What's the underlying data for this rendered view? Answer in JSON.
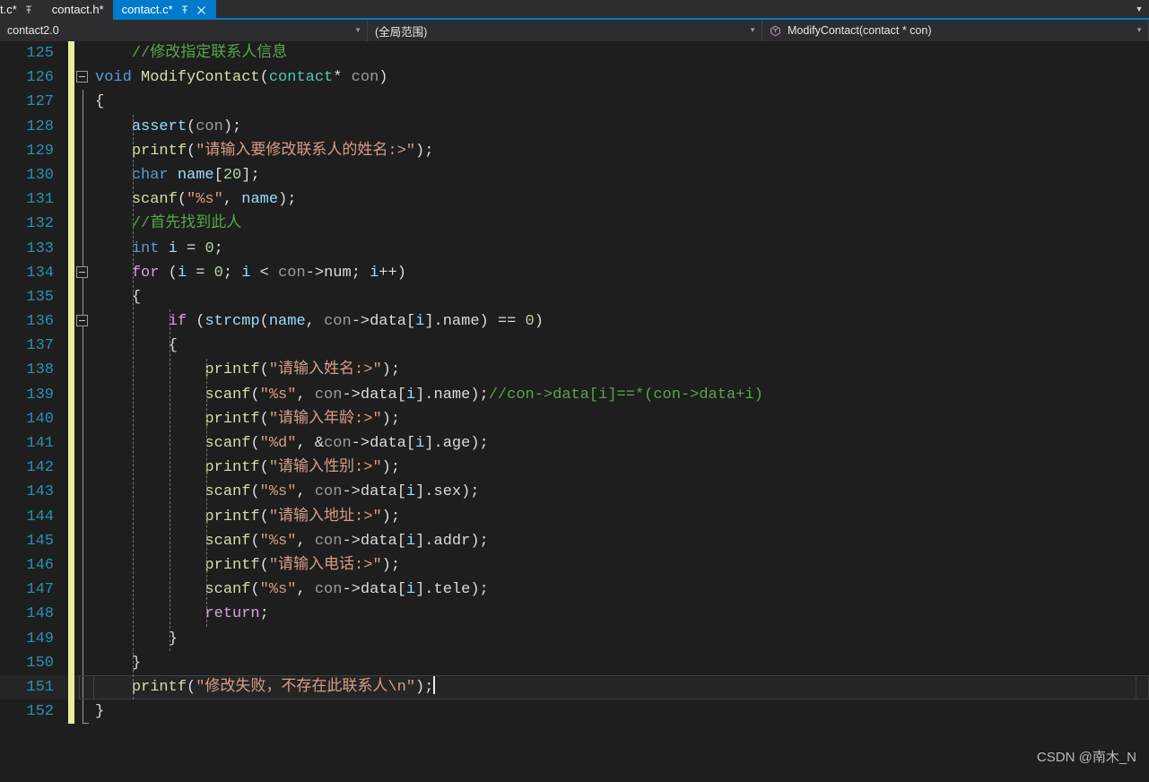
{
  "window": {
    "theme_bg": "#1e1e1e",
    "accent": "#007acc"
  },
  "tabs": [
    {
      "label": "t.c*",
      "state": "partial-left",
      "active": false,
      "pin": true,
      "close": false
    },
    {
      "label": "contact.h*",
      "state": "inactive",
      "active": false,
      "pin": false,
      "close": false
    },
    {
      "label": "contact.c*",
      "state": "active",
      "active": true,
      "pin": true,
      "close": true
    }
  ],
  "tabstrip": {
    "overflow_icon": "chevron-down-icon"
  },
  "navbar": {
    "project": "contact2.0",
    "scope": "(全局范围)",
    "member": "ModifyContact(contact * con)",
    "member_icon": "method-cube-icon",
    "dropdown_icon": "chevron-down-icon"
  },
  "editor": {
    "first_line": 125,
    "current_line": 151,
    "lines": [
      {
        "n": 125,
        "changed": true,
        "collapse": false,
        "tokens": [
          {
            "t": "    ",
            "c": "k-pun"
          },
          {
            "t": "//修改指定联系人信息",
            "c": "k-cmt"
          }
        ]
      },
      {
        "n": 126,
        "changed": true,
        "collapse": true,
        "vline": false,
        "tokens": [
          {
            "t": "void ",
            "c": "k-blue"
          },
          {
            "t": "ModifyContact",
            "c": "k-fn"
          },
          {
            "t": "(",
            "c": "k-pun"
          },
          {
            "t": "contact",
            "c": "k-type"
          },
          {
            "t": "* ",
            "c": "k-pun"
          },
          {
            "t": "con",
            "c": "k-dim"
          },
          {
            "t": ")",
            "c": "k-pun"
          }
        ]
      },
      {
        "n": 127,
        "changed": true,
        "vline": true,
        "tokens": [
          {
            "t": "{",
            "c": "k-brk"
          }
        ]
      },
      {
        "n": 128,
        "changed": true,
        "vline": true,
        "tokens": [
          {
            "t": "    ",
            "c": "k-pun"
          },
          {
            "t": "assert",
            "c": "k-var"
          },
          {
            "t": "(",
            "c": "k-pun"
          },
          {
            "t": "con",
            "c": "k-dim"
          },
          {
            "t": ");",
            "c": "k-pun"
          }
        ]
      },
      {
        "n": 129,
        "changed": true,
        "vline": true,
        "tokens": [
          {
            "t": "    ",
            "c": "k-pun"
          },
          {
            "t": "printf",
            "c": "k-fn"
          },
          {
            "t": "(",
            "c": "k-pun"
          },
          {
            "t": "\"请输入要修改联系人的姓名:>\"",
            "c": "k-str"
          },
          {
            "t": ");",
            "c": "k-pun"
          }
        ]
      },
      {
        "n": 130,
        "changed": true,
        "vline": true,
        "tokens": [
          {
            "t": "    ",
            "c": "k-pun"
          },
          {
            "t": "char ",
            "c": "k-blue"
          },
          {
            "t": "name",
            "c": "k-var"
          },
          {
            "t": "[",
            "c": "k-pun"
          },
          {
            "t": "20",
            "c": "k-num"
          },
          {
            "t": "];",
            "c": "k-pun"
          }
        ]
      },
      {
        "n": 131,
        "changed": true,
        "vline": true,
        "tokens": [
          {
            "t": "    ",
            "c": "k-pun"
          },
          {
            "t": "scanf",
            "c": "k-fn"
          },
          {
            "t": "(",
            "c": "k-pun"
          },
          {
            "t": "\"%s\"",
            "c": "k-str"
          },
          {
            "t": ", ",
            "c": "k-pun"
          },
          {
            "t": "name",
            "c": "k-var"
          },
          {
            "t": ");",
            "c": "k-pun"
          }
        ]
      },
      {
        "n": 132,
        "changed": true,
        "vline": true,
        "tokens": [
          {
            "t": "    ",
            "c": "k-pun"
          },
          {
            "t": "//首先找到此人",
            "c": "k-cmt"
          }
        ]
      },
      {
        "n": 133,
        "changed": true,
        "vline": true,
        "tokens": [
          {
            "t": "    ",
            "c": "k-pun"
          },
          {
            "t": "int ",
            "c": "k-blue"
          },
          {
            "t": "i",
            "c": "k-var"
          },
          {
            "t": " = ",
            "c": "k-pun"
          },
          {
            "t": "0",
            "c": "k-num"
          },
          {
            "t": ";",
            "c": "k-pun"
          }
        ]
      },
      {
        "n": 134,
        "changed": true,
        "collapse": true,
        "vline": true,
        "tokens": [
          {
            "t": "    ",
            "c": "k-pun"
          },
          {
            "t": "for",
            "c": "k-pink"
          },
          {
            "t": " (",
            "c": "k-pun"
          },
          {
            "t": "i",
            "c": "k-var"
          },
          {
            "t": " = ",
            "c": "k-pun"
          },
          {
            "t": "0",
            "c": "k-num"
          },
          {
            "t": "; ",
            "c": "k-pun"
          },
          {
            "t": "i",
            "c": "k-var"
          },
          {
            "t": " < ",
            "c": "k-pun"
          },
          {
            "t": "con",
            "c": "k-dim"
          },
          {
            "t": "->",
            "c": "k-pun"
          },
          {
            "t": "num",
            "c": "k-mem"
          },
          {
            "t": "; ",
            "c": "k-pun"
          },
          {
            "t": "i",
            "c": "k-var"
          },
          {
            "t": "++)",
            "c": "k-pun"
          }
        ]
      },
      {
        "n": 135,
        "changed": true,
        "vline": true,
        "tokens": [
          {
            "t": "    ",
            "c": "k-pun"
          },
          {
            "t": "{",
            "c": "k-brk"
          }
        ]
      },
      {
        "n": 136,
        "changed": true,
        "collapse": true,
        "vline": true,
        "tokens": [
          {
            "t": "        ",
            "c": "k-pun"
          },
          {
            "t": "if",
            "c": "k-pink"
          },
          {
            "t": " (",
            "c": "k-pun"
          },
          {
            "t": "strcmp",
            "c": "k-var"
          },
          {
            "t": "(",
            "c": "k-pun"
          },
          {
            "t": "name",
            "c": "k-var"
          },
          {
            "t": ", ",
            "c": "k-pun"
          },
          {
            "t": "con",
            "c": "k-dim"
          },
          {
            "t": "->",
            "c": "k-pun"
          },
          {
            "t": "data",
            "c": "k-mem"
          },
          {
            "t": "[",
            "c": "k-pun"
          },
          {
            "t": "i",
            "c": "k-var"
          },
          {
            "t": "].",
            "c": "k-pun"
          },
          {
            "t": "name",
            "c": "k-mem"
          },
          {
            "t": ") == ",
            "c": "k-pun"
          },
          {
            "t": "0",
            "c": "k-num"
          },
          {
            "t": ")",
            "c": "k-pun"
          }
        ]
      },
      {
        "n": 137,
        "changed": true,
        "vline": true,
        "tokens": [
          {
            "t": "        ",
            "c": "k-pun"
          },
          {
            "t": "{",
            "c": "k-brk"
          }
        ]
      },
      {
        "n": 138,
        "changed": true,
        "vline": true,
        "tokens": [
          {
            "t": "            ",
            "c": "k-pun"
          },
          {
            "t": "printf",
            "c": "k-fn"
          },
          {
            "t": "(",
            "c": "k-pun"
          },
          {
            "t": "\"请输入姓名:>\"",
            "c": "k-str"
          },
          {
            "t": ");",
            "c": "k-pun"
          }
        ]
      },
      {
        "n": 139,
        "changed": true,
        "vline": true,
        "tokens": [
          {
            "t": "            ",
            "c": "k-pun"
          },
          {
            "t": "scanf",
            "c": "k-fn"
          },
          {
            "t": "(",
            "c": "k-pun"
          },
          {
            "t": "\"%s\"",
            "c": "k-str"
          },
          {
            "t": ", ",
            "c": "k-pun"
          },
          {
            "t": "con",
            "c": "k-dim"
          },
          {
            "t": "->",
            "c": "k-pun"
          },
          {
            "t": "data",
            "c": "k-mem"
          },
          {
            "t": "[",
            "c": "k-pun"
          },
          {
            "t": "i",
            "c": "k-var"
          },
          {
            "t": "].",
            "c": "k-pun"
          },
          {
            "t": "name",
            "c": "k-mem"
          },
          {
            "t": ");",
            "c": "k-pun"
          },
          {
            "t": "//con->data[i]==*(con->data+i)",
            "c": "k-cmt"
          }
        ]
      },
      {
        "n": 140,
        "changed": true,
        "vline": true,
        "tokens": [
          {
            "t": "            ",
            "c": "k-pun"
          },
          {
            "t": "printf",
            "c": "k-fn"
          },
          {
            "t": "(",
            "c": "k-pun"
          },
          {
            "t": "\"请输入年龄:>\"",
            "c": "k-str"
          },
          {
            "t": ");",
            "c": "k-pun"
          }
        ]
      },
      {
        "n": 141,
        "changed": true,
        "vline": true,
        "tokens": [
          {
            "t": "            ",
            "c": "k-pun"
          },
          {
            "t": "scanf",
            "c": "k-fn"
          },
          {
            "t": "(",
            "c": "k-pun"
          },
          {
            "t": "\"%d\"",
            "c": "k-str"
          },
          {
            "t": ", &",
            "c": "k-pun"
          },
          {
            "t": "con",
            "c": "k-dim"
          },
          {
            "t": "->",
            "c": "k-pun"
          },
          {
            "t": "data",
            "c": "k-mem"
          },
          {
            "t": "[",
            "c": "k-pun"
          },
          {
            "t": "i",
            "c": "k-var"
          },
          {
            "t": "].",
            "c": "k-pun"
          },
          {
            "t": "age",
            "c": "k-mem"
          },
          {
            "t": ");",
            "c": "k-pun"
          }
        ]
      },
      {
        "n": 142,
        "changed": true,
        "vline": true,
        "tokens": [
          {
            "t": "            ",
            "c": "k-pun"
          },
          {
            "t": "printf",
            "c": "k-fn"
          },
          {
            "t": "(",
            "c": "k-pun"
          },
          {
            "t": "\"请输入性别:>\"",
            "c": "k-str"
          },
          {
            "t": ");",
            "c": "k-pun"
          }
        ]
      },
      {
        "n": 143,
        "changed": true,
        "vline": true,
        "tokens": [
          {
            "t": "            ",
            "c": "k-pun"
          },
          {
            "t": "scanf",
            "c": "k-fn"
          },
          {
            "t": "(",
            "c": "k-pun"
          },
          {
            "t": "\"%s\"",
            "c": "k-str"
          },
          {
            "t": ", ",
            "c": "k-pun"
          },
          {
            "t": "con",
            "c": "k-dim"
          },
          {
            "t": "->",
            "c": "k-pun"
          },
          {
            "t": "data",
            "c": "k-mem"
          },
          {
            "t": "[",
            "c": "k-pun"
          },
          {
            "t": "i",
            "c": "k-var"
          },
          {
            "t": "].",
            "c": "k-pun"
          },
          {
            "t": "sex",
            "c": "k-mem"
          },
          {
            "t": ");",
            "c": "k-pun"
          }
        ]
      },
      {
        "n": 144,
        "changed": true,
        "vline": true,
        "tokens": [
          {
            "t": "            ",
            "c": "k-pun"
          },
          {
            "t": "printf",
            "c": "k-fn"
          },
          {
            "t": "(",
            "c": "k-pun"
          },
          {
            "t": "\"请输入地址:>\"",
            "c": "k-str"
          },
          {
            "t": ");",
            "c": "k-pun"
          }
        ]
      },
      {
        "n": 145,
        "changed": true,
        "vline": true,
        "tokens": [
          {
            "t": "            ",
            "c": "k-pun"
          },
          {
            "t": "scanf",
            "c": "k-fn"
          },
          {
            "t": "(",
            "c": "k-pun"
          },
          {
            "t": "\"%s\"",
            "c": "k-str"
          },
          {
            "t": ", ",
            "c": "k-pun"
          },
          {
            "t": "con",
            "c": "k-dim"
          },
          {
            "t": "->",
            "c": "k-pun"
          },
          {
            "t": "data",
            "c": "k-mem"
          },
          {
            "t": "[",
            "c": "k-pun"
          },
          {
            "t": "i",
            "c": "k-var"
          },
          {
            "t": "].",
            "c": "k-pun"
          },
          {
            "t": "addr",
            "c": "k-mem"
          },
          {
            "t": ");",
            "c": "k-pun"
          }
        ]
      },
      {
        "n": 146,
        "changed": true,
        "vline": true,
        "tokens": [
          {
            "t": "            ",
            "c": "k-pun"
          },
          {
            "t": "printf",
            "c": "k-fn"
          },
          {
            "t": "(",
            "c": "k-pun"
          },
          {
            "t": "\"请输入电话:>\"",
            "c": "k-str"
          },
          {
            "t": ");",
            "c": "k-pun"
          }
        ]
      },
      {
        "n": 147,
        "changed": true,
        "vline": true,
        "tokens": [
          {
            "t": "            ",
            "c": "k-pun"
          },
          {
            "t": "scanf",
            "c": "k-fn"
          },
          {
            "t": "(",
            "c": "k-pun"
          },
          {
            "t": "\"%s\"",
            "c": "k-str"
          },
          {
            "t": ", ",
            "c": "k-pun"
          },
          {
            "t": "con",
            "c": "k-dim"
          },
          {
            "t": "->",
            "c": "k-pun"
          },
          {
            "t": "data",
            "c": "k-mem"
          },
          {
            "t": "[",
            "c": "k-pun"
          },
          {
            "t": "i",
            "c": "k-var"
          },
          {
            "t": "].",
            "c": "k-pun"
          },
          {
            "t": "tele",
            "c": "k-mem"
          },
          {
            "t": ");",
            "c": "k-pun"
          }
        ]
      },
      {
        "n": 148,
        "changed": true,
        "vline": true,
        "tokens": [
          {
            "t": "            ",
            "c": "k-pun"
          },
          {
            "t": "return",
            "c": "k-pink"
          },
          {
            "t": ";",
            "c": "k-pun"
          }
        ]
      },
      {
        "n": 149,
        "changed": true,
        "vline": true,
        "tokens": [
          {
            "t": "        ",
            "c": "k-pun"
          },
          {
            "t": "}",
            "c": "k-brk"
          }
        ]
      },
      {
        "n": 150,
        "changed": true,
        "vline": true,
        "tokens": [
          {
            "t": "    ",
            "c": "k-pun"
          },
          {
            "t": "}",
            "c": "k-brk"
          }
        ]
      },
      {
        "n": 151,
        "changed": true,
        "vline": true,
        "current": true,
        "tokens": [
          {
            "t": "    ",
            "c": "k-pun"
          },
          {
            "t": "printf",
            "c": "k-fn"
          },
          {
            "t": "(",
            "c": "k-pun"
          },
          {
            "t": "\"修改失败，不存在此联系人\\n\"",
            "c": "k-str"
          },
          {
            "t": ");",
            "c": "k-pun"
          }
        ]
      },
      {
        "n": 152,
        "changed": true,
        "vline": true,
        "vline_cap": true,
        "tokens": [
          {
            "t": "}",
            "c": "k-brk"
          }
        ]
      }
    ]
  },
  "watermark": {
    "text": "CSDN @南木_N"
  }
}
